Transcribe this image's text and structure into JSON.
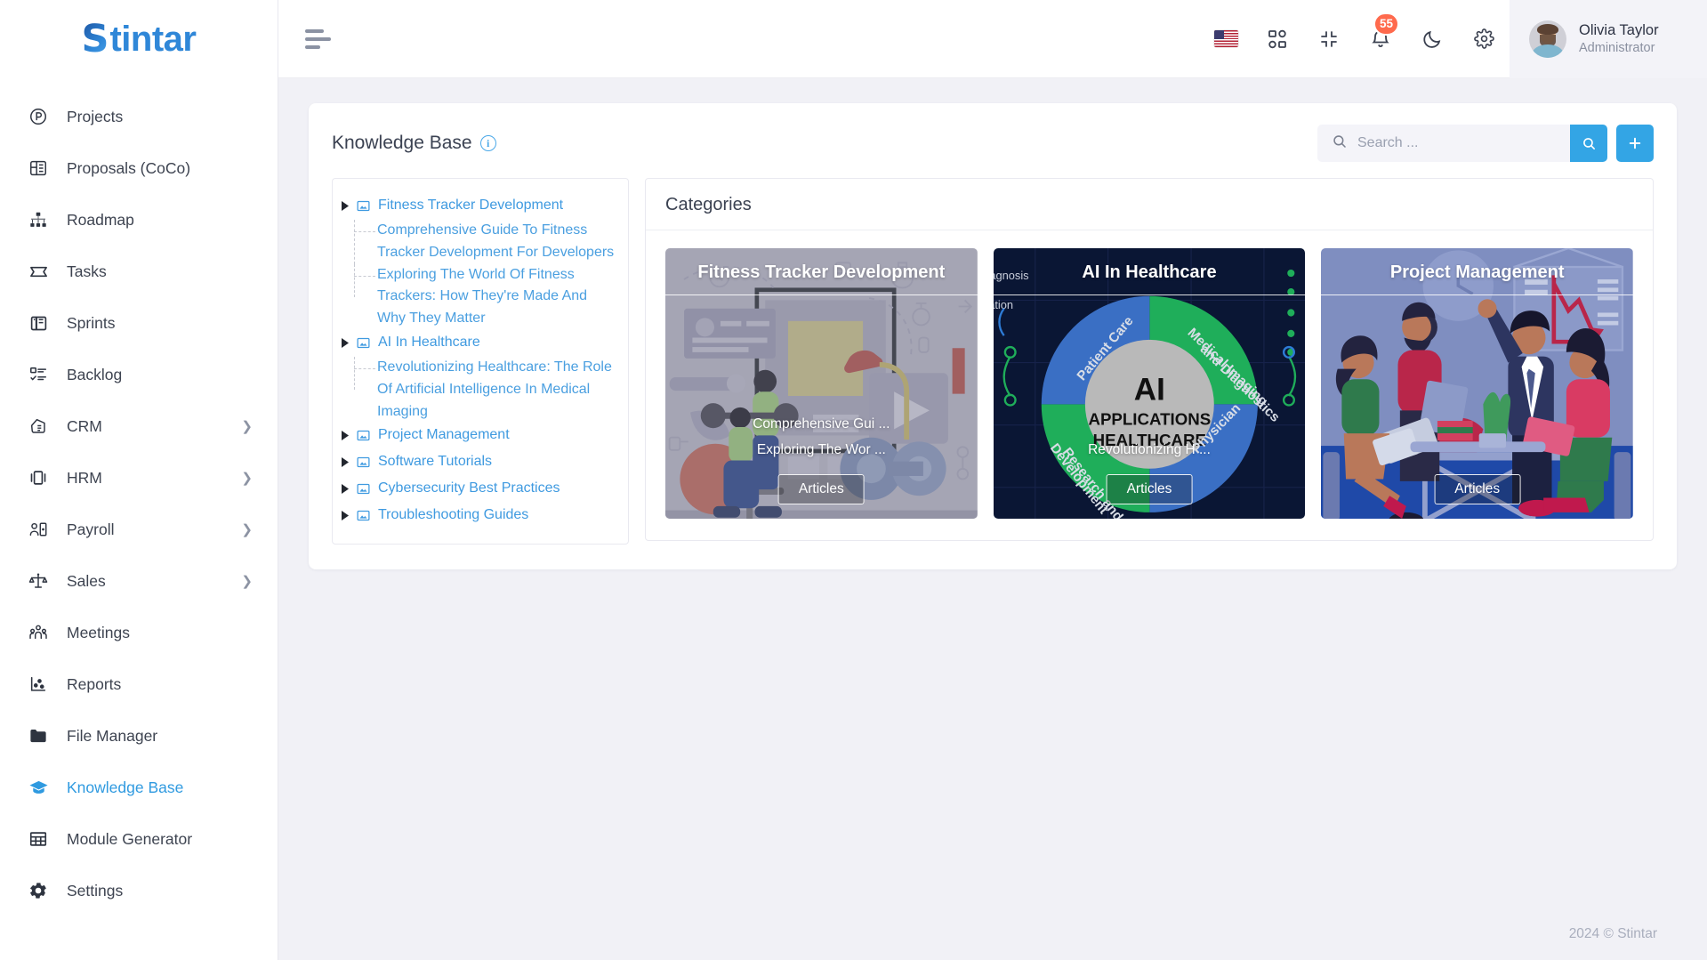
{
  "brand": {
    "prefix": "S",
    "rest": "tintar"
  },
  "sidebar": {
    "items": [
      {
        "label": "Projects",
        "icon": "project-circle-icon",
        "chevron": false,
        "active": false
      },
      {
        "label": "Proposals (CoCo)",
        "icon": "proposal-icon",
        "chevron": false,
        "active": false
      },
      {
        "label": "Roadmap",
        "icon": "roadmap-hierarchy-icon",
        "chevron": false,
        "active": false
      },
      {
        "label": "Tasks",
        "icon": "ticket-icon",
        "chevron": false,
        "active": false
      },
      {
        "label": "Sprints",
        "icon": "board-icon",
        "chevron": false,
        "active": false
      },
      {
        "label": "Backlog",
        "icon": "checklist-icon",
        "chevron": false,
        "active": false
      },
      {
        "label": "CRM",
        "icon": "handshake-icon",
        "chevron": true,
        "active": false
      },
      {
        "label": "HRM",
        "icon": "id-card-icon",
        "chevron": true,
        "active": false
      },
      {
        "label": "Payroll",
        "icon": "person-badge-icon",
        "chevron": true,
        "active": false
      },
      {
        "label": "Sales",
        "icon": "scale-balance-icon",
        "chevron": true,
        "active": false
      },
      {
        "label": "Meetings",
        "icon": "people-group-icon",
        "chevron": false,
        "active": false
      },
      {
        "label": "Reports",
        "icon": "scatter-chart-icon",
        "chevron": false,
        "active": false
      },
      {
        "label": "File Manager",
        "icon": "folder-icon",
        "chevron": false,
        "active": false
      },
      {
        "label": "Knowledge Base",
        "icon": "graduation-cap-icon",
        "chevron": false,
        "active": true
      },
      {
        "label": "Module Generator",
        "icon": "grid-table-icon",
        "chevron": false,
        "active": false
      },
      {
        "label": "Settings",
        "icon": "gear-icon",
        "chevron": false,
        "active": false
      }
    ]
  },
  "topbar": {
    "menu_toggle": "hamburger-icon",
    "language_flag": "us-flag-icon",
    "apps_icon": "apps-grid-icon",
    "fullscreen_icon": "compress-icon",
    "notifications_icon": "bell-icon",
    "notifications_count": "55",
    "theme_icon": "moon-icon",
    "settings_icon": "gear-icon",
    "user": {
      "name": "Olivia Taylor",
      "role": "Administrator"
    }
  },
  "page": {
    "title": "Knowledge Base",
    "info_glyph": "i",
    "search": {
      "placeholder": "Search ...",
      "value": ""
    },
    "search_button_icon": "search-icon",
    "add_button_icon": "plus-icon"
  },
  "tree": [
    {
      "label": "Fitness Tracker Development",
      "children": [
        "Comprehensive Guide To Fitness Tracker Development For Developers",
        "Exploring The World Of Fitness Trackers: How They're Made And Why They Matter"
      ]
    },
    {
      "label": "AI In Healthcare",
      "children": [
        "Revolutionizing Healthcare: The Role Of Artificial Intelligence In Medical Imaging"
      ]
    },
    {
      "label": "Project Management",
      "children": []
    },
    {
      "label": "Software Tutorials",
      "children": []
    },
    {
      "label": "Cybersecurity Best Practices",
      "children": []
    },
    {
      "label": "Troubleshooting Guides",
      "children": []
    }
  ],
  "categories": {
    "heading": "Categories",
    "cards": [
      {
        "title": "Fitness Tracker Development",
        "links": [
          "Comprehensive Gui ...",
          "Exploring The Wor ..."
        ],
        "button": "Articles",
        "theme": "fitness"
      },
      {
        "title": "AI In Healthcare",
        "links": [
          "Revolutionizing H ..."
        ],
        "button": "Articles",
        "theme": "ai",
        "diagram": {
          "center_lines": [
            "AI",
            "APPLICATIONS",
            "HEALTHCARE"
          ],
          "segments": [
            "Patient Care",
            "Medical Imaging and Diagnostics",
            "Research and Development",
            "Physician"
          ],
          "side_labels": [
            "agnosis",
            "tation"
          ]
        }
      },
      {
        "title": "Project Management",
        "links": [],
        "button": "Articles",
        "theme": "pm"
      }
    ]
  },
  "footer": {
    "copyright": "2024 © Stintar"
  },
  "colors": {
    "accent": "#33a5e5",
    "link": "#4a9fe0",
    "badge": "#ff6a4d",
    "page_bg": "#f1f1f6",
    "text": "#3b4252"
  }
}
